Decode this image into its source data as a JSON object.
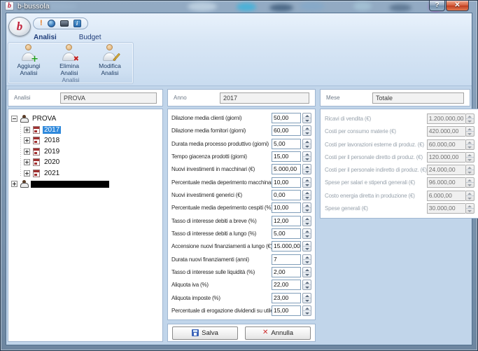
{
  "window": {
    "title": "b-bussola",
    "icon_letter": "b",
    "help_label": "?",
    "close_label": "✕"
  },
  "app": {
    "orb_letter": "b"
  },
  "tabs": [
    {
      "label": "Analisi"
    },
    {
      "label": "Budget"
    }
  ],
  "ribbon": {
    "group_label": "Analisi",
    "buttons": [
      {
        "line1": "Aggiungi",
        "line2": "Analisi"
      },
      {
        "line1": "Elimina",
        "line2": "Analisi"
      },
      {
        "line1": "Modifica",
        "line2": "Analisi"
      }
    ]
  },
  "header_fields": [
    {
      "label": "Analisi",
      "value": "PROVA"
    },
    {
      "label": "Anno",
      "value": "2017"
    },
    {
      "label": "Mese",
      "value": "Totale"
    }
  ],
  "tree": {
    "root_label": "PROVA",
    "years": [
      {
        "label": "2017",
        "selected": true
      },
      {
        "label": "2018"
      },
      {
        "label": "2019"
      },
      {
        "label": "2020"
      },
      {
        "label": "2021"
      }
    ]
  },
  "budget_form": {
    "rows": [
      {
        "label": "Dilazione media clienti (giorni)",
        "value": "50,00"
      },
      {
        "label": "Dilazione media fornitori (giorni)",
        "value": "60,00"
      },
      {
        "label": "Durata media processo produttivo (giorni)",
        "value": "5,00"
      },
      {
        "label": "Tempo giacenza prodotti (giorni)",
        "value": "15,00"
      },
      {
        "label": "Nuovi investimenti in macchinari (€)",
        "value": "5.000,00"
      },
      {
        "label": "Percentuale media deperimento macchinari (%)",
        "value": "10,00"
      },
      {
        "label": "Nuovi investimenti generici (€)",
        "value": "0,00"
      },
      {
        "label": "Percentuale media deperimento cespiti (%)",
        "value": "10,00"
      },
      {
        "label": "Tasso di interesse debiti a breve (%)",
        "value": "12,00"
      },
      {
        "label": "Tasso di interesse debiti a lungo (%)",
        "value": "5,00"
      },
      {
        "label": "Accensione nuovi finanziamenti a lungo (€)",
        "value": "15.000,00"
      },
      {
        "label": "Durata nuovi finanziamenti (anni)",
        "value": "7"
      },
      {
        "label": "Tasso di interesse sulle liquidità (%)",
        "value": "2,00"
      },
      {
        "label": "Aliquota iva (%)",
        "value": "22,00"
      },
      {
        "label": "Aliquota imposte (%)",
        "value": "23,00"
      },
      {
        "label": "Percentuale di erogazione dividendi su utile (%)",
        "value": "15,00"
      }
    ]
  },
  "economics_form": {
    "rows": [
      {
        "label": "Ricavi di vendita (€)",
        "value": "1.200.000,00"
      },
      {
        "label": "Costi per consumo materie (€)",
        "value": "420.000,00"
      },
      {
        "label": "Costi per lavorazioni esterne di produz. (€)",
        "value": "60.000,00"
      },
      {
        "label": "Costi per il personale diretto di produz. (€)",
        "value": "120.000,00"
      },
      {
        "label": "Costi per il personale indiretto di produz. (€)",
        "value": "24.000,00"
      },
      {
        "label": "Spese per salari e stipendi generali (€)",
        "value": "96.000,00"
      },
      {
        "label": "Costo energia diretta in produzione (€)",
        "value": "6.000,00"
      },
      {
        "label": "Spese generali (€)",
        "value": "30.000,00"
      }
    ]
  },
  "actions": {
    "save_label": "Salva",
    "cancel_label": "Annulla"
  },
  "colors": {
    "selection_blue": "#2f89dc",
    "close_red": "#bf3c1e",
    "tab_text": "#1f3d7a"
  }
}
